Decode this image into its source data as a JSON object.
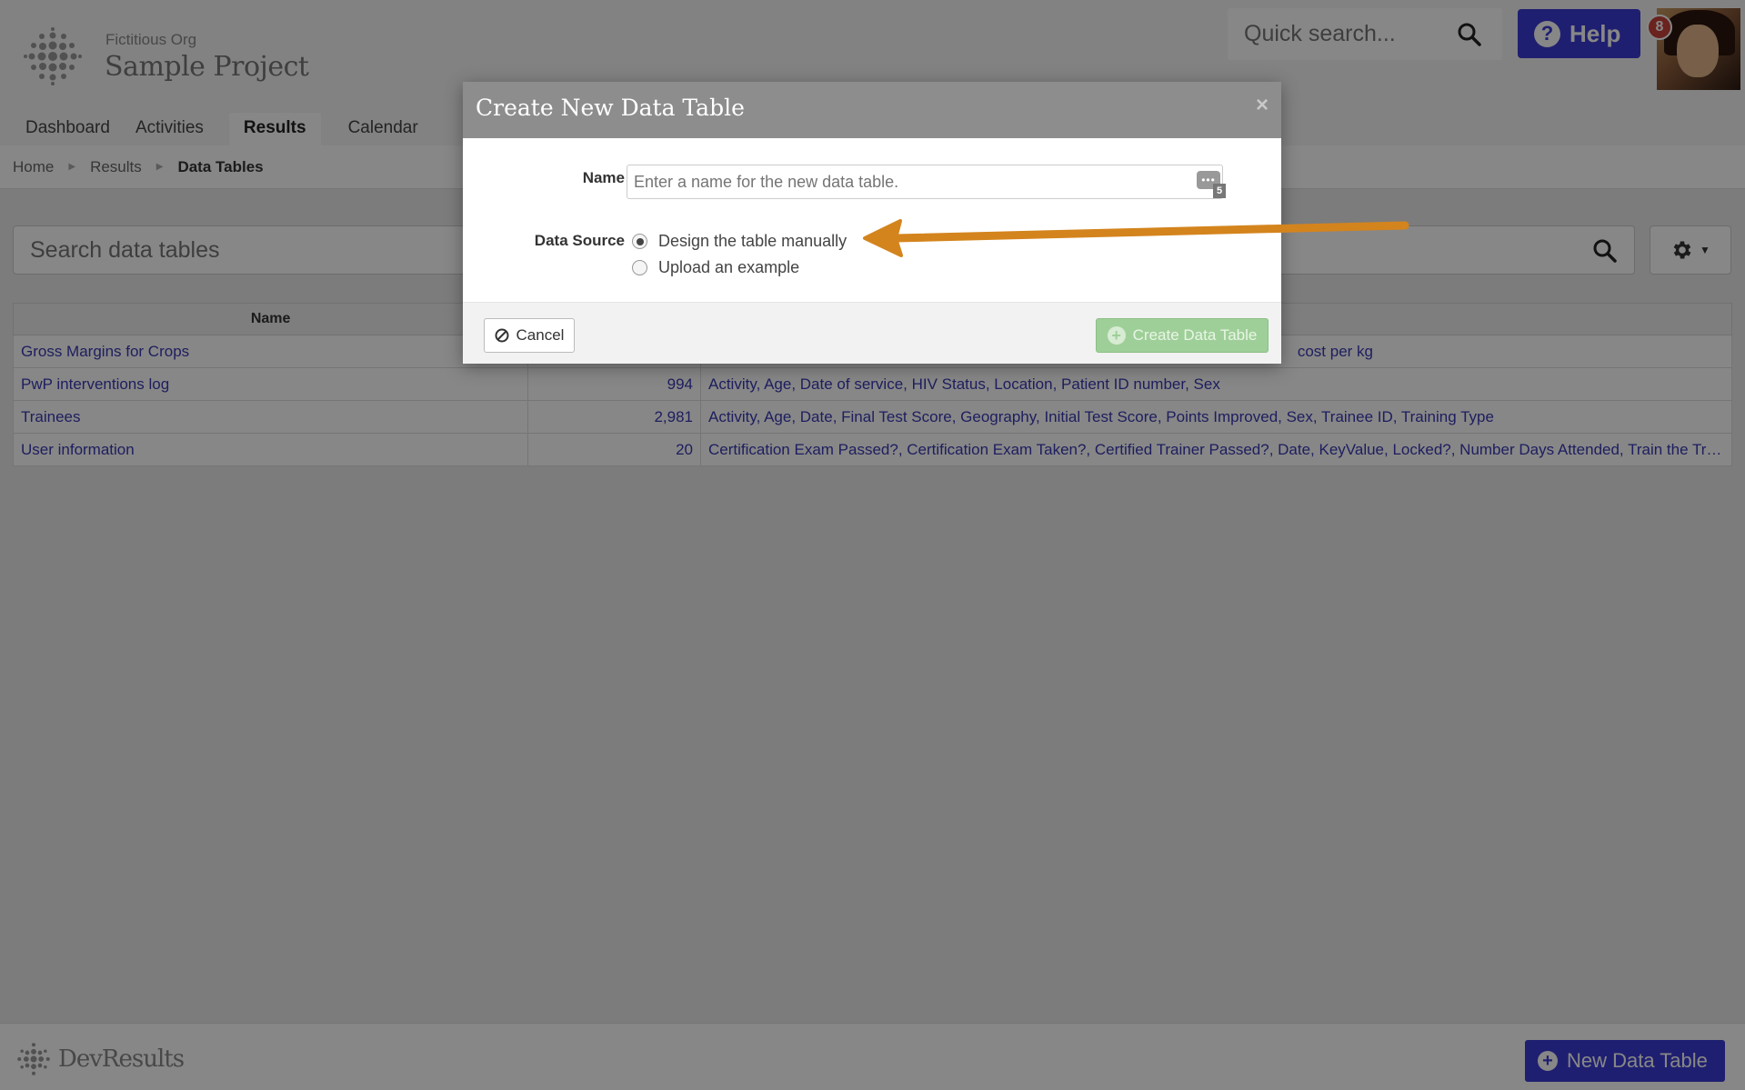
{
  "header": {
    "org_name": "Fictitious Org",
    "project_name": "Sample Project",
    "quick_search_placeholder": "Quick search...",
    "help_label": "Help",
    "notification_count": "8"
  },
  "nav": {
    "tabs": [
      {
        "label": "Dashboard"
      },
      {
        "label": "Activities"
      },
      {
        "label": "Results"
      },
      {
        "label": "Calendar"
      }
    ]
  },
  "breadcrumb": {
    "items": [
      "Home",
      "Results",
      "Data Tables"
    ]
  },
  "toolbar": {
    "search_placeholder": "Search data tables"
  },
  "table": {
    "headers": [
      "Name",
      "",
      ""
    ],
    "rows": [
      {
        "name": "Gross Margins for Crops",
        "rows": "",
        "columns": "cost per kg"
      },
      {
        "name": "PwP interventions log",
        "rows": "994",
        "columns": "Activity, Age, Date of service, HIV Status, Location, Patient ID number, Sex"
      },
      {
        "name": "Trainees",
        "rows": "2,981",
        "columns": "Activity, Age, Date, Final Test Score, Geography, Initial Test Score, Points Improved, Sex, Trainee ID, Training Type"
      },
      {
        "name": "User information",
        "rows": "20",
        "columns": "Certification Exam Passed?, Certification Exam Taken?, Certified Trainer Passed?, Date, KeyValue, Locked?, Number Days Attended, Train the Trai..."
      }
    ]
  },
  "footer": {
    "brand": "DevResults",
    "new_table_label": "New Data Table"
  },
  "modal": {
    "title": "Create New Data Table",
    "close_symbol": "×",
    "name_label": "Name",
    "name_placeholder": "Enter a name for the new data table.",
    "name_badge_count": "5",
    "data_source_label": "Data Source",
    "options": [
      {
        "label": "Design the table manually",
        "checked": true
      },
      {
        "label": "Upload an example",
        "checked": false
      }
    ],
    "cancel_label": "Cancel",
    "create_label": "Create Data Table"
  },
  "colors": {
    "accent": "#3b3bd6",
    "link": "#3a3ab5",
    "annotation_arrow": "#d4841d",
    "create_disabled": "#9fcf98"
  }
}
